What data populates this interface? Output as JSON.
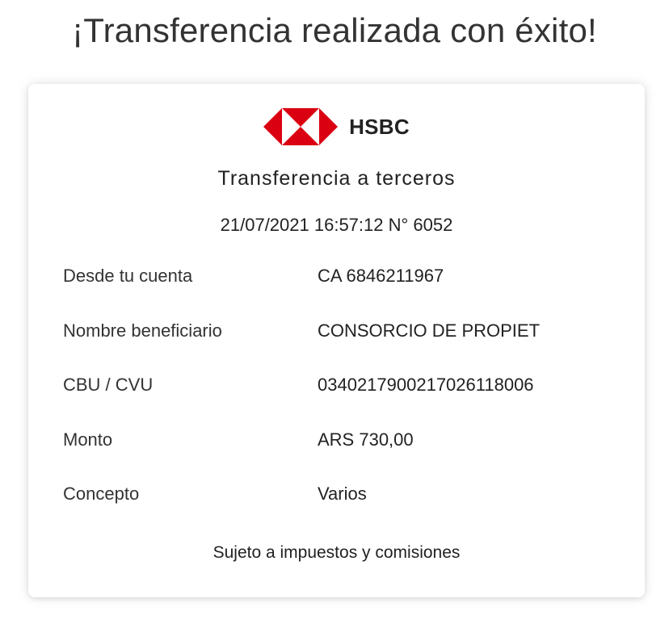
{
  "header": {
    "title": "¡Transferencia realizada con éxito!"
  },
  "receipt": {
    "brand": {
      "logo_icon": "hsbc-hexagon-logo",
      "name": "HSBC",
      "colors": {
        "red": "#db0011",
        "white": "#ffffff"
      }
    },
    "title": "Transferencia a terceros",
    "meta": "21/07/2021 16:57:12 N° 6052",
    "details": [
      {
        "label": "Desde tu cuenta",
        "value": "CA 6846211967"
      },
      {
        "label": "Nombre beneficiario",
        "value": "CONSORCIO DE PROPIET"
      },
      {
        "label": "CBU / CVU",
        "value": "0340217900217026118006"
      },
      {
        "label": "Monto",
        "value": "ARS 730,00"
      },
      {
        "label": "Concepto",
        "value": "Varios"
      }
    ],
    "footnote": "Sujeto a impuestos y comisiones"
  }
}
